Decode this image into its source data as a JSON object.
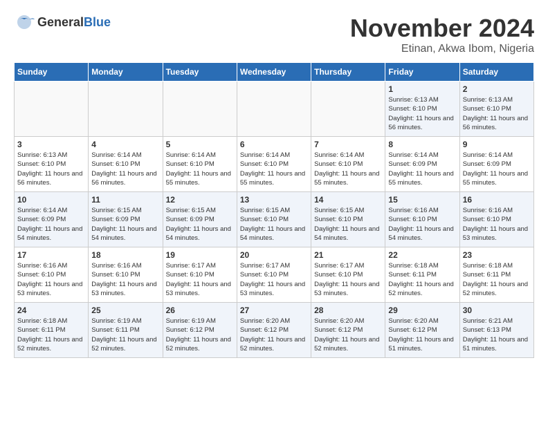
{
  "logo": {
    "general": "General",
    "blue": "Blue"
  },
  "title": "November 2024",
  "subtitle": "Etinan, Akwa Ibom, Nigeria",
  "days_of_week": [
    "Sunday",
    "Monday",
    "Tuesday",
    "Wednesday",
    "Thursday",
    "Friday",
    "Saturday"
  ],
  "weeks": [
    [
      {
        "day": "",
        "info": ""
      },
      {
        "day": "",
        "info": ""
      },
      {
        "day": "",
        "info": ""
      },
      {
        "day": "",
        "info": ""
      },
      {
        "day": "",
        "info": ""
      },
      {
        "day": "1",
        "info": "Sunrise: 6:13 AM\nSunset: 6:10 PM\nDaylight: 11 hours and 56 minutes."
      },
      {
        "day": "2",
        "info": "Sunrise: 6:13 AM\nSunset: 6:10 PM\nDaylight: 11 hours and 56 minutes."
      }
    ],
    [
      {
        "day": "3",
        "info": "Sunrise: 6:13 AM\nSunset: 6:10 PM\nDaylight: 11 hours and 56 minutes."
      },
      {
        "day": "4",
        "info": "Sunrise: 6:14 AM\nSunset: 6:10 PM\nDaylight: 11 hours and 56 minutes."
      },
      {
        "day": "5",
        "info": "Sunrise: 6:14 AM\nSunset: 6:10 PM\nDaylight: 11 hours and 55 minutes."
      },
      {
        "day": "6",
        "info": "Sunrise: 6:14 AM\nSunset: 6:10 PM\nDaylight: 11 hours and 55 minutes."
      },
      {
        "day": "7",
        "info": "Sunrise: 6:14 AM\nSunset: 6:10 PM\nDaylight: 11 hours and 55 minutes."
      },
      {
        "day": "8",
        "info": "Sunrise: 6:14 AM\nSunset: 6:09 PM\nDaylight: 11 hours and 55 minutes."
      },
      {
        "day": "9",
        "info": "Sunrise: 6:14 AM\nSunset: 6:09 PM\nDaylight: 11 hours and 55 minutes."
      }
    ],
    [
      {
        "day": "10",
        "info": "Sunrise: 6:14 AM\nSunset: 6:09 PM\nDaylight: 11 hours and 54 minutes."
      },
      {
        "day": "11",
        "info": "Sunrise: 6:15 AM\nSunset: 6:09 PM\nDaylight: 11 hours and 54 minutes."
      },
      {
        "day": "12",
        "info": "Sunrise: 6:15 AM\nSunset: 6:09 PM\nDaylight: 11 hours and 54 minutes."
      },
      {
        "day": "13",
        "info": "Sunrise: 6:15 AM\nSunset: 6:10 PM\nDaylight: 11 hours and 54 minutes."
      },
      {
        "day": "14",
        "info": "Sunrise: 6:15 AM\nSunset: 6:10 PM\nDaylight: 11 hours and 54 minutes."
      },
      {
        "day": "15",
        "info": "Sunrise: 6:16 AM\nSunset: 6:10 PM\nDaylight: 11 hours and 54 minutes."
      },
      {
        "day": "16",
        "info": "Sunrise: 6:16 AM\nSunset: 6:10 PM\nDaylight: 11 hours and 53 minutes."
      }
    ],
    [
      {
        "day": "17",
        "info": "Sunrise: 6:16 AM\nSunset: 6:10 PM\nDaylight: 11 hours and 53 minutes."
      },
      {
        "day": "18",
        "info": "Sunrise: 6:16 AM\nSunset: 6:10 PM\nDaylight: 11 hours and 53 minutes."
      },
      {
        "day": "19",
        "info": "Sunrise: 6:17 AM\nSunset: 6:10 PM\nDaylight: 11 hours and 53 minutes."
      },
      {
        "day": "20",
        "info": "Sunrise: 6:17 AM\nSunset: 6:10 PM\nDaylight: 11 hours and 53 minutes."
      },
      {
        "day": "21",
        "info": "Sunrise: 6:17 AM\nSunset: 6:10 PM\nDaylight: 11 hours and 53 minutes."
      },
      {
        "day": "22",
        "info": "Sunrise: 6:18 AM\nSunset: 6:11 PM\nDaylight: 11 hours and 52 minutes."
      },
      {
        "day": "23",
        "info": "Sunrise: 6:18 AM\nSunset: 6:11 PM\nDaylight: 11 hours and 52 minutes."
      }
    ],
    [
      {
        "day": "24",
        "info": "Sunrise: 6:18 AM\nSunset: 6:11 PM\nDaylight: 11 hours and 52 minutes."
      },
      {
        "day": "25",
        "info": "Sunrise: 6:19 AM\nSunset: 6:11 PM\nDaylight: 11 hours and 52 minutes."
      },
      {
        "day": "26",
        "info": "Sunrise: 6:19 AM\nSunset: 6:12 PM\nDaylight: 11 hours and 52 minutes."
      },
      {
        "day": "27",
        "info": "Sunrise: 6:20 AM\nSunset: 6:12 PM\nDaylight: 11 hours and 52 minutes."
      },
      {
        "day": "28",
        "info": "Sunrise: 6:20 AM\nSunset: 6:12 PM\nDaylight: 11 hours and 52 minutes."
      },
      {
        "day": "29",
        "info": "Sunrise: 6:20 AM\nSunset: 6:12 PM\nDaylight: 11 hours and 51 minutes."
      },
      {
        "day": "30",
        "info": "Sunrise: 6:21 AM\nSunset: 6:13 PM\nDaylight: 11 hours and 51 minutes."
      }
    ]
  ]
}
